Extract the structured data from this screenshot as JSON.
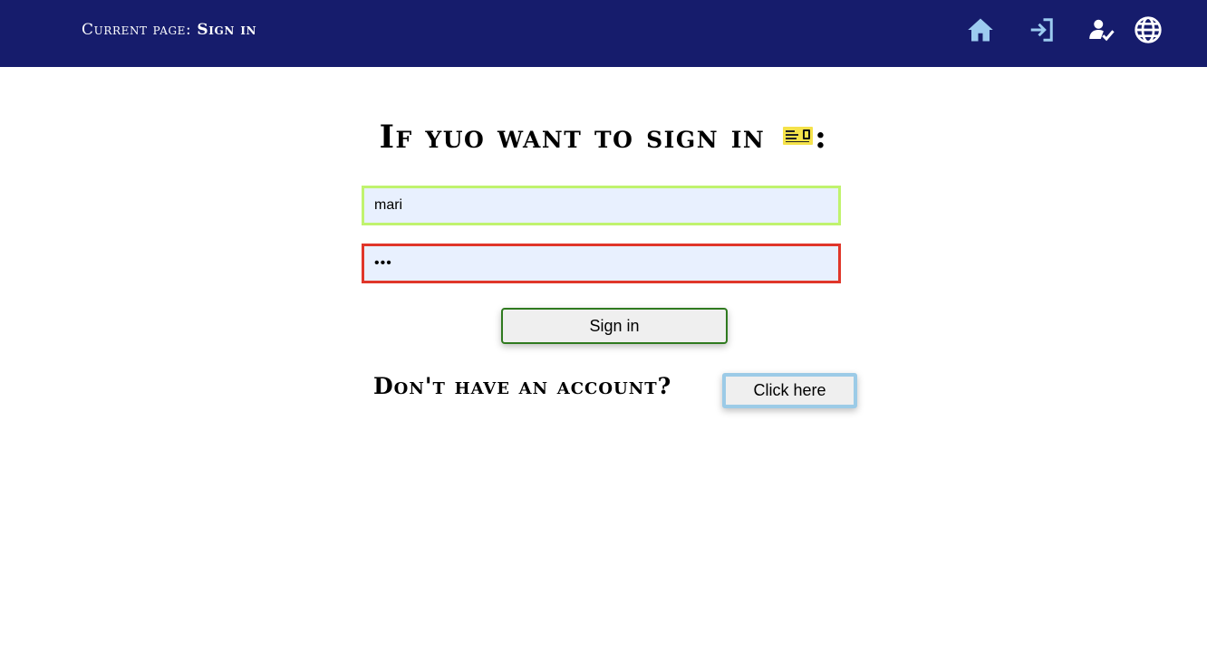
{
  "header": {
    "current_page_prefix": "Current page: ",
    "current_page_name": "Sign in",
    "nav": [
      {
        "icon": "home-icon",
        "color": "#9ccbf0"
      },
      {
        "icon": "login-icon",
        "color": "#9ccbf0"
      },
      {
        "icon": "user-check-icon",
        "color": "#ffffff"
      },
      {
        "icon": "globe-icon",
        "color": "#ffffff"
      }
    ],
    "background": "#161c6c"
  },
  "main": {
    "heading_text": "If yuo want to sign in",
    "heading_suffix": ":",
    "heading_image": "concert-ticket-icon",
    "username_value": "mari",
    "password_value": "•••",
    "signin_label": "Sign in",
    "no_account_text": "Don't have an account?",
    "click_here_label": "Click here"
  },
  "colors": {
    "username_border": "#c0f36e",
    "password_border": "#e0362a",
    "signin_border": "#2f7a1f",
    "click_here_border": "#9ccbe7"
  }
}
